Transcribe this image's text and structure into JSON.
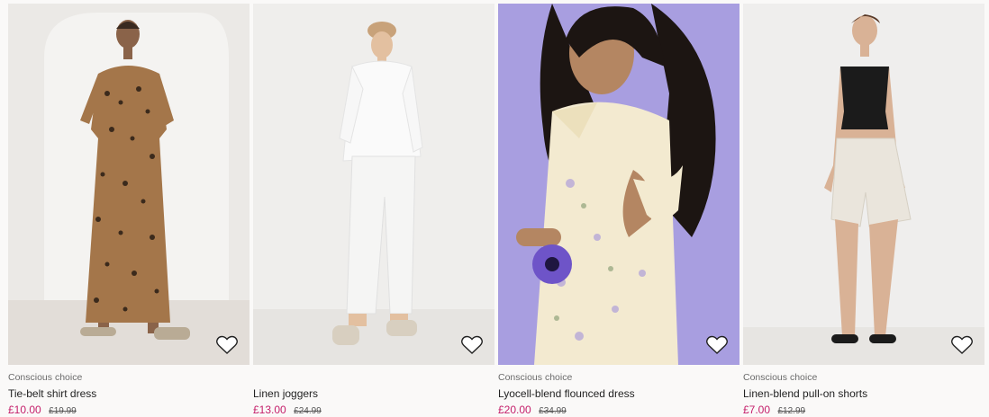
{
  "products": [
    {
      "tag": "Conscious choice",
      "name": "Tie-belt shirt dress",
      "price": "£10.00",
      "old_price": "£19.99",
      "favorite_icon": "heart-outline-icon"
    },
    {
      "tag": "",
      "name": "Linen joggers",
      "price": "£13.00",
      "old_price": "£24.99",
      "favorite_icon": "heart-outline-icon"
    },
    {
      "tag": "Conscious choice",
      "name": "Lyocell-blend flounced dress",
      "price": "£20.00",
      "old_price": "£34.99",
      "favorite_icon": "heart-outline-icon"
    },
    {
      "tag": "Conscious choice",
      "name": "Linen-blend pull-on shorts",
      "price": "£7.00",
      "old_price": "£12.99",
      "favorite_icon": "heart-outline-icon"
    }
  ],
  "colors": {
    "sale_price": "#c41e6a",
    "background": "#faf9f8",
    "lavender_backdrop": "#a89ee0"
  }
}
